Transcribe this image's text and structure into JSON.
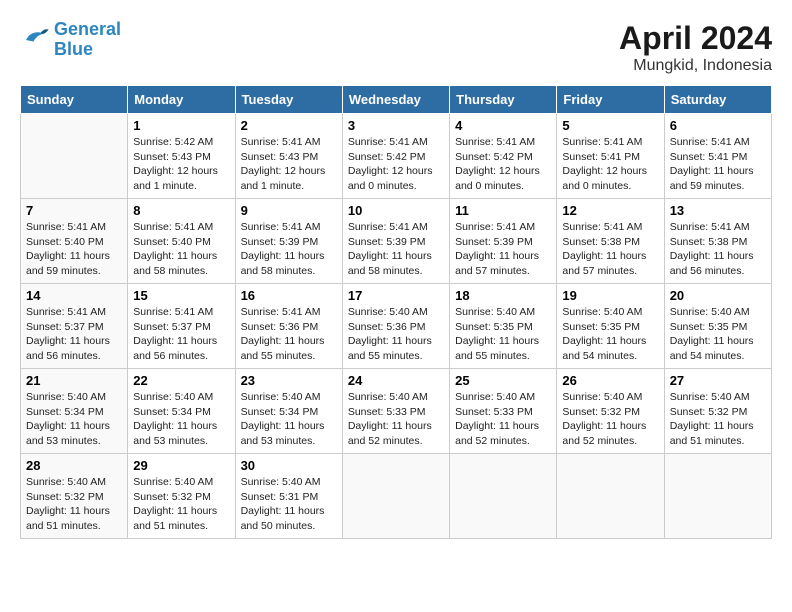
{
  "header": {
    "logo_line1": "General",
    "logo_line2": "Blue",
    "month": "April 2024",
    "location": "Mungkid, Indonesia"
  },
  "days_of_week": [
    "Sunday",
    "Monday",
    "Tuesday",
    "Wednesday",
    "Thursday",
    "Friday",
    "Saturday"
  ],
  "weeks": [
    [
      {
        "day": "",
        "info": ""
      },
      {
        "day": "1",
        "info": "Sunrise: 5:42 AM\nSunset: 5:43 PM\nDaylight: 12 hours\nand 1 minute."
      },
      {
        "day": "2",
        "info": "Sunrise: 5:41 AM\nSunset: 5:43 PM\nDaylight: 12 hours\nand 1 minute."
      },
      {
        "day": "3",
        "info": "Sunrise: 5:41 AM\nSunset: 5:42 PM\nDaylight: 12 hours\nand 0 minutes."
      },
      {
        "day": "4",
        "info": "Sunrise: 5:41 AM\nSunset: 5:42 PM\nDaylight: 12 hours\nand 0 minutes."
      },
      {
        "day": "5",
        "info": "Sunrise: 5:41 AM\nSunset: 5:41 PM\nDaylight: 12 hours\nand 0 minutes."
      },
      {
        "day": "6",
        "info": "Sunrise: 5:41 AM\nSunset: 5:41 PM\nDaylight: 11 hours\nand 59 minutes."
      }
    ],
    [
      {
        "day": "7",
        "info": "Sunrise: 5:41 AM\nSunset: 5:40 PM\nDaylight: 11 hours\nand 59 minutes."
      },
      {
        "day": "8",
        "info": "Sunrise: 5:41 AM\nSunset: 5:40 PM\nDaylight: 11 hours\nand 58 minutes."
      },
      {
        "day": "9",
        "info": "Sunrise: 5:41 AM\nSunset: 5:39 PM\nDaylight: 11 hours\nand 58 minutes."
      },
      {
        "day": "10",
        "info": "Sunrise: 5:41 AM\nSunset: 5:39 PM\nDaylight: 11 hours\nand 58 minutes."
      },
      {
        "day": "11",
        "info": "Sunrise: 5:41 AM\nSunset: 5:39 PM\nDaylight: 11 hours\nand 57 minutes."
      },
      {
        "day": "12",
        "info": "Sunrise: 5:41 AM\nSunset: 5:38 PM\nDaylight: 11 hours\nand 57 minutes."
      },
      {
        "day": "13",
        "info": "Sunrise: 5:41 AM\nSunset: 5:38 PM\nDaylight: 11 hours\nand 56 minutes."
      }
    ],
    [
      {
        "day": "14",
        "info": "Sunrise: 5:41 AM\nSunset: 5:37 PM\nDaylight: 11 hours\nand 56 minutes."
      },
      {
        "day": "15",
        "info": "Sunrise: 5:41 AM\nSunset: 5:37 PM\nDaylight: 11 hours\nand 56 minutes."
      },
      {
        "day": "16",
        "info": "Sunrise: 5:41 AM\nSunset: 5:36 PM\nDaylight: 11 hours\nand 55 minutes."
      },
      {
        "day": "17",
        "info": "Sunrise: 5:40 AM\nSunset: 5:36 PM\nDaylight: 11 hours\nand 55 minutes."
      },
      {
        "day": "18",
        "info": "Sunrise: 5:40 AM\nSunset: 5:35 PM\nDaylight: 11 hours\nand 55 minutes."
      },
      {
        "day": "19",
        "info": "Sunrise: 5:40 AM\nSunset: 5:35 PM\nDaylight: 11 hours\nand 54 minutes."
      },
      {
        "day": "20",
        "info": "Sunrise: 5:40 AM\nSunset: 5:35 PM\nDaylight: 11 hours\nand 54 minutes."
      }
    ],
    [
      {
        "day": "21",
        "info": "Sunrise: 5:40 AM\nSunset: 5:34 PM\nDaylight: 11 hours\nand 53 minutes."
      },
      {
        "day": "22",
        "info": "Sunrise: 5:40 AM\nSunset: 5:34 PM\nDaylight: 11 hours\nand 53 minutes."
      },
      {
        "day": "23",
        "info": "Sunrise: 5:40 AM\nSunset: 5:34 PM\nDaylight: 11 hours\nand 53 minutes."
      },
      {
        "day": "24",
        "info": "Sunrise: 5:40 AM\nSunset: 5:33 PM\nDaylight: 11 hours\nand 52 minutes."
      },
      {
        "day": "25",
        "info": "Sunrise: 5:40 AM\nSunset: 5:33 PM\nDaylight: 11 hours\nand 52 minutes."
      },
      {
        "day": "26",
        "info": "Sunrise: 5:40 AM\nSunset: 5:32 PM\nDaylight: 11 hours\nand 52 minutes."
      },
      {
        "day": "27",
        "info": "Sunrise: 5:40 AM\nSunset: 5:32 PM\nDaylight: 11 hours\nand 51 minutes."
      }
    ],
    [
      {
        "day": "28",
        "info": "Sunrise: 5:40 AM\nSunset: 5:32 PM\nDaylight: 11 hours\nand 51 minutes."
      },
      {
        "day": "29",
        "info": "Sunrise: 5:40 AM\nSunset: 5:32 PM\nDaylight: 11 hours\nand 51 minutes."
      },
      {
        "day": "30",
        "info": "Sunrise: 5:40 AM\nSunset: 5:31 PM\nDaylight: 11 hours\nand 50 minutes."
      },
      {
        "day": "",
        "info": ""
      },
      {
        "day": "",
        "info": ""
      },
      {
        "day": "",
        "info": ""
      },
      {
        "day": "",
        "info": ""
      }
    ]
  ]
}
